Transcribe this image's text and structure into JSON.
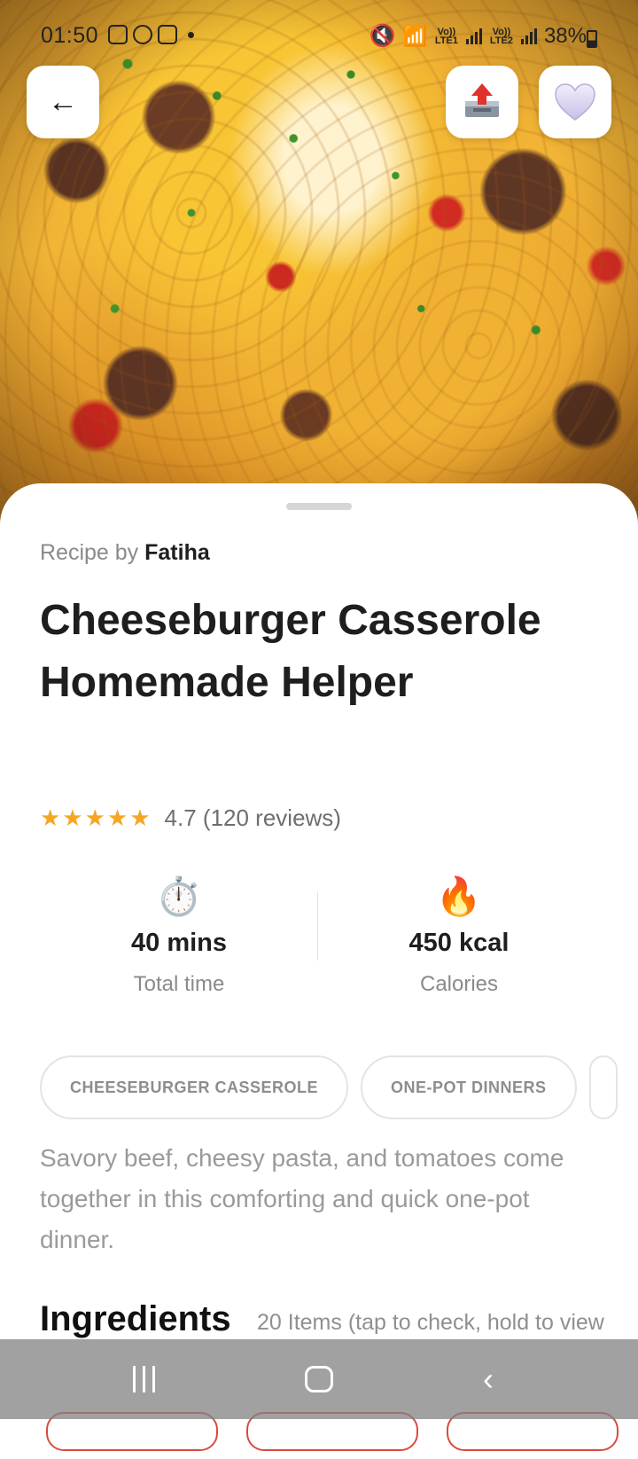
{
  "status_bar": {
    "time": "01:50",
    "battery": "38%",
    "sim1": "Vo)) LTE1",
    "sim2": "Vo)) LTE2"
  },
  "header": {
    "back_icon": "←",
    "share_icon": "outbox-tray-icon",
    "favorite_icon": "heart-icon"
  },
  "recipe": {
    "byline_prefix": "Recipe by",
    "author": "Fatiha",
    "title": "Cheeseburger Casserole Homemade Helper",
    "stars": "★★★★★",
    "rating_text": "4.7 (120 reviews)",
    "rating_value": 4.7,
    "time_icon": "⏱️",
    "time_value": "40 mins",
    "time_label": "Total time",
    "calories_icon": "🔥",
    "calories_value": "450 kcal",
    "calories_label": "Calories",
    "tags": [
      "CHEESEBURGER CASSEROLE",
      "ONE-POT DINNERS"
    ],
    "description": "Savory beef, cheesy pasta, and tomatoes come together in this comforting and quick one-pot dinner.",
    "ingredients_heading": "Ingredients",
    "ingredients_count": "20 Items (tap to check, hold to view"
  },
  "colors": {
    "star": "#f5a623",
    "title": "#1e1e1e",
    "muted": "#8a8a8a",
    "accent_pill": "#d94b3f"
  }
}
